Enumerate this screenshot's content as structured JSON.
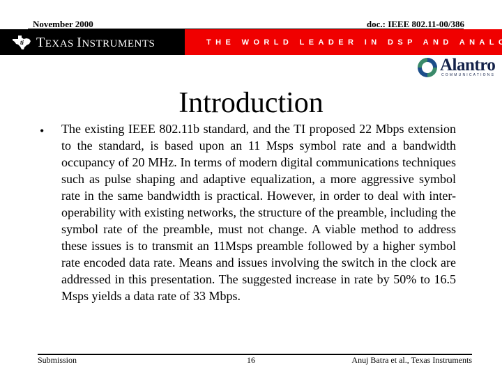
{
  "header": {
    "date": "November 2000",
    "doc_id": "doc.: IEEE 802.11-00/386"
  },
  "banner": {
    "company_name": "Texas Instruments",
    "company_name_first": "T",
    "company_name_rest_1": "EXAS ",
    "company_name_second": "I",
    "company_name_rest_2": "NSTRUMENTS",
    "tagline": "The World Leader in DSP and Analog",
    "colors": {
      "black": "#000000",
      "red": "#f00000"
    }
  },
  "partner_logo": {
    "name": "Alantro",
    "subtitle": "COMMUNICATIONS",
    "colors": {
      "text": "#14224a",
      "ring_blue": "#1c4e8a",
      "ring_green": "#3a8a6a"
    }
  },
  "slide": {
    "title": "Introduction",
    "bullet_glyph": "•",
    "bullets": [
      "The existing IEEE 802.11b standard, and the TI proposed 22 Mbps extension to the standard, is based upon an 11 Msps symbol rate and a bandwidth occupancy of 20 MHz.  In terms of modern digital communications techniques such as pulse shaping and adaptive equalization, a more aggressive symbol rate in the same bandwidth is practical.  However, in order to deal with inter-operability with existing networks, the structure of the preamble, including the symbol rate of the preamble, must not change.  A viable method to address these issues is to transmit an 11Msps preamble followed by a higher symbol rate encoded data rate.  Means and issues involving the switch in the clock are addressed in this presentation.  The suggested increase in rate by 50% to 16.5 Msps yields a data rate of 33 Mbps."
    ]
  },
  "footer": {
    "left": "Submission",
    "page_number": "16",
    "right": "Anuj Batra et al., Texas Instruments"
  }
}
